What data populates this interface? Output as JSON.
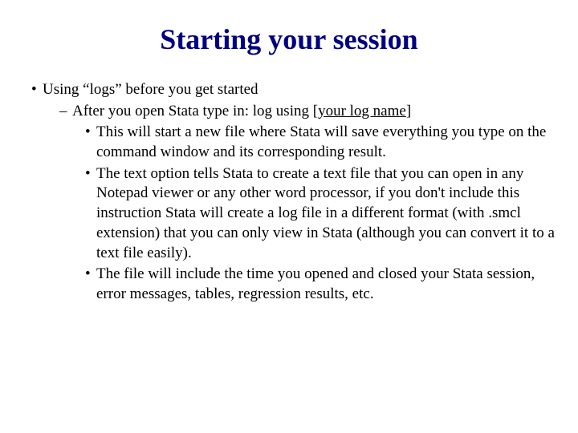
{
  "title": "Starting your session",
  "b1": "Using “logs” before you get started",
  "b2_pre": "After you open Stata type in: log using [",
  "b2_u": "your log name",
  "b2_post": "]",
  "b3": "This will start a new file where Stata will save everything you type on the command window and its corresponding result.",
  "b4": "The text option tells Stata to create a text file that you can open in any Notepad viewer or any other word processor, if you don't include this instruction Stata will create a log file in a different format (with .smcl extension) that you can only view in Stata (although you can convert it to a text file easily).",
  "b5": "The file will include the time you opened and closed your Stata session, error messages, tables, regression results, etc."
}
